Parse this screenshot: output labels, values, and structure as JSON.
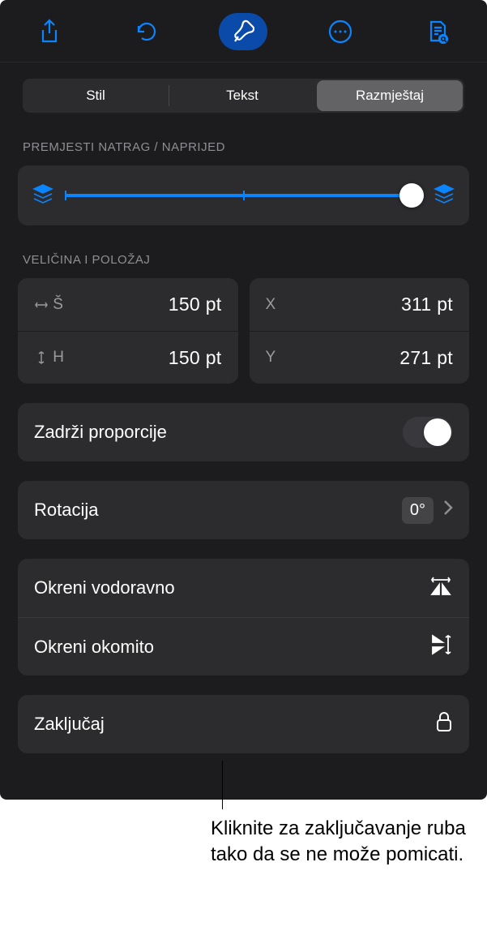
{
  "toolbar": {
    "share": "share-icon",
    "undo": "undo-icon",
    "format": "paintbrush-icon",
    "more": "ellipsis-icon",
    "document": "document-icon"
  },
  "tabs": {
    "style": "Stil",
    "text": "Tekst",
    "layout": "Razmještaj"
  },
  "sections": {
    "move": "PREMJESTI NATRAG / NAPRIJED",
    "size_pos": "VELIČINA I POLOŽAJ"
  },
  "size": {
    "w_label": "Š",
    "w_value": "150 pt",
    "h_label": "H",
    "h_value": "150 pt"
  },
  "position": {
    "x_label": "X",
    "x_value": "311 pt",
    "y_label": "Y",
    "y_value": "271 pt"
  },
  "rows": {
    "constrain": "Zadrži proporcije",
    "rotation": "Rotacija",
    "rotation_value": "0°",
    "flip_h": "Okreni vodoravno",
    "flip_v": "Okreni okomito",
    "lock": "Zaključaj"
  },
  "callout": "Kliknite za zaključavanje ruba tako da se ne može pomicati."
}
